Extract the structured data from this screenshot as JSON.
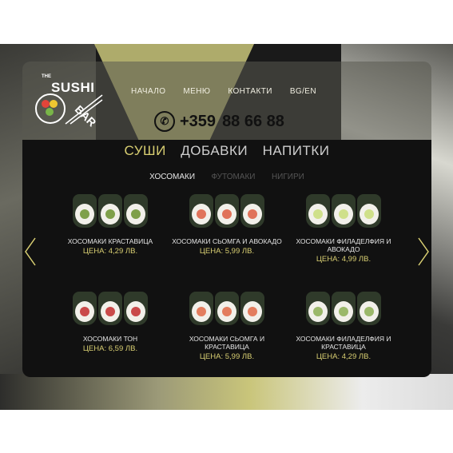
{
  "brand": {
    "the": "THE",
    "sushi": "SUSHI",
    "bar": "BAR"
  },
  "nav": {
    "home": "НАЧАЛО",
    "menu": "МЕНЮ",
    "contacts": "КОНТАКТИ",
    "lang": "BG/EN"
  },
  "phone": {
    "code": "+359",
    "number": "88 66 88"
  },
  "categories": [
    {
      "label": "СУШИ",
      "active": true
    },
    {
      "label": "ДОБАВКИ",
      "active": false
    },
    {
      "label": "НАПИТКИ",
      "active": false
    }
  ],
  "subcategories": [
    {
      "label": "ХОСОМАКИ",
      "active": true
    },
    {
      "label": "ФУТОМАКИ",
      "active": false
    },
    {
      "label": "НИГИРИ",
      "active": false
    }
  ],
  "products": [
    {
      "name": "ХОСОМАКИ КРАСТАВИЦА",
      "price": "ЦЕНА: 4,29 ЛВ.",
      "fill": "#7fa04a"
    },
    {
      "name": "ХОСОМАКИ СЬОМГА И АВОКАДО",
      "price": "ЦЕНА: 5,99 ЛВ.",
      "fill": "#e0735a"
    },
    {
      "name": "ХОСОМАКИ ФИЛАДЕЛФИЯ И АВОКАДО",
      "price": "ЦЕНА: 4,99 ЛВ.",
      "fill": "#cfe08a"
    },
    {
      "name": "ХОСОМАКИ ТОН",
      "price": "ЦЕНА: 6,59 ЛВ.",
      "fill": "#c94a4a"
    },
    {
      "name": "ХОСОМАКИ СЬОМГА И КРАСТАВИЦА",
      "price": "ЦЕНА: 5,99 ЛВ.",
      "fill": "#e37d5e"
    },
    {
      "name": "ХОСОМАКИ ФИЛАДЕЛФИЯ И КРАСТАВИЦА",
      "price": "ЦЕНА: 4,29 ЛВ.",
      "fill": "#9bb86a"
    }
  ],
  "colors": {
    "accent": "#d9cf72",
    "yellow_bg": "#c9c57a",
    "panel": "#111111"
  },
  "icons": {
    "phone": "phone-icon",
    "prev": "chevron-left-icon",
    "next": "chevron-right-icon"
  }
}
